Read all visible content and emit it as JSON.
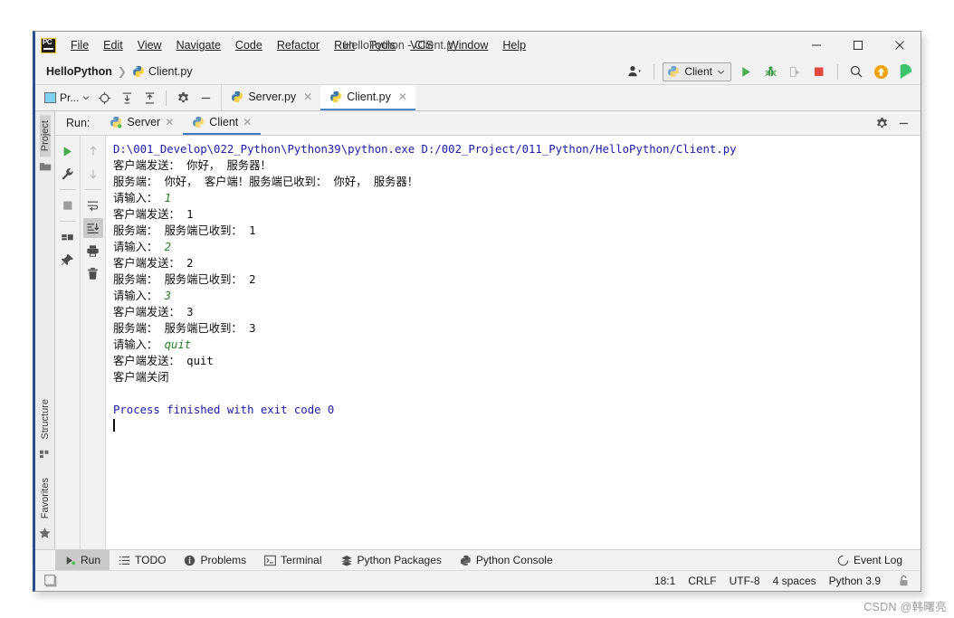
{
  "window": {
    "title": "HelloPython - Client.py",
    "app_logo": "pycharm-logo",
    "controls": {
      "minimize": "─",
      "maximize": "☐",
      "close": "✕"
    }
  },
  "menu": [
    {
      "label": "File",
      "mnemonic": "F"
    },
    {
      "label": "Edit",
      "mnemonic": "E"
    },
    {
      "label": "View",
      "mnemonic": "V"
    },
    {
      "label": "Navigate",
      "mnemonic": "N"
    },
    {
      "label": "Code",
      "mnemonic": "C"
    },
    {
      "label": "Refactor",
      "mnemonic": "R"
    },
    {
      "label": "Run",
      "mnemonic": "u"
    },
    {
      "label": "Tools",
      "mnemonic": "T"
    },
    {
      "label": "VCS",
      "mnemonic": "S"
    },
    {
      "label": "Window",
      "mnemonic": "W"
    },
    {
      "label": "Help",
      "mnemonic": "H"
    }
  ],
  "navbar": {
    "project": "HelloPython",
    "separator": "❯",
    "file": "Client.py",
    "run_config": "Client",
    "run_config_chevron": "⌄",
    "icons": [
      "user-avatar-icon",
      "run-icon",
      "debug-icon",
      "coverage-icon",
      "stop-icon",
      "search-everywhere-icon",
      "update-icon",
      "ide-features-icon"
    ]
  },
  "tabstrip": {
    "project_chip": "Pr...",
    "tool_icons": [
      "target-locate-icon",
      "expand-all-icon",
      "collapse-all-icon",
      "settings-gear-icon",
      "hide-icon"
    ],
    "editor_tabs": [
      {
        "label": "Server.py",
        "active": false,
        "close": "✕"
      },
      {
        "label": "Client.py",
        "active": true,
        "close": "✕"
      }
    ]
  },
  "leftbar": {
    "top": [
      {
        "label": "Project",
        "selected": true,
        "icon": "folder-icon"
      }
    ],
    "bottom": [
      {
        "label": "Structure",
        "selected": false,
        "icon": "structure-icon"
      },
      {
        "label": "Favorites",
        "selected": false,
        "icon": "star-icon"
      }
    ]
  },
  "run_window": {
    "label": "Run:",
    "tabs": [
      {
        "label": "Server",
        "active": false,
        "running": true,
        "close": "✕"
      },
      {
        "label": "Client",
        "active": true,
        "running": false,
        "close": "✕"
      }
    ],
    "right_icons": [
      "settings-gear-icon",
      "hide-window-icon"
    ],
    "gutter_left": [
      "rerun-icon",
      "wrench-settings-icon",
      "stop-icon",
      "layout-icon",
      "pin-icon"
    ],
    "gutter_right": [
      "scroll-up-icon",
      "scroll-down-icon",
      "soft-wrap-icon",
      "scroll-to-end-icon",
      "print-icon",
      "clear-all-icon"
    ]
  },
  "console": {
    "lines": [
      {
        "type": "cmd",
        "text": "D:\\001_Develop\\022_Python\\Python39\\python.exe D:/002_Project/011_Python/HelloPython/Client.py"
      },
      {
        "type": "out",
        "text": "客户端发送： 你好， 服务器！"
      },
      {
        "type": "out",
        "text": "服务端： 你好， 客户端！服务端已收到： 你好， 服务器！"
      },
      {
        "type": "prompt",
        "text": "请输入： ",
        "input": "1"
      },
      {
        "type": "out",
        "text": "客户端发送： 1"
      },
      {
        "type": "out",
        "text": "服务端： 服务端已收到： 1"
      },
      {
        "type": "prompt",
        "text": "请输入： ",
        "input": "2"
      },
      {
        "type": "out",
        "text": "客户端发送： 2"
      },
      {
        "type": "out",
        "text": "服务端： 服务端已收到： 2"
      },
      {
        "type": "prompt",
        "text": "请输入： ",
        "input": "3"
      },
      {
        "type": "out",
        "text": "客户端发送： 3"
      },
      {
        "type": "out",
        "text": "服务端： 服务端已收到： 3"
      },
      {
        "type": "prompt",
        "text": "请输入： ",
        "input": "quit"
      },
      {
        "type": "out",
        "text": "客户端发送： quit"
      },
      {
        "type": "out",
        "text": "客户端关闭"
      },
      {
        "type": "blank",
        "text": ""
      },
      {
        "type": "exit",
        "text": "Process finished with exit code 0"
      },
      {
        "type": "caret",
        "text": ""
      }
    ]
  },
  "bottom_bar": {
    "items": [
      {
        "label": "Run",
        "icon": "run-icon",
        "selected": true
      },
      {
        "label": "TODO",
        "icon": "todo-list-icon",
        "selected": false
      },
      {
        "label": "Problems",
        "icon": "problems-icon",
        "selected": false
      },
      {
        "label": "Terminal",
        "icon": "terminal-icon",
        "selected": false
      },
      {
        "label": "Python Packages",
        "icon": "packages-icon",
        "selected": false
      },
      {
        "label": "Python Console",
        "icon": "python-icon",
        "selected": false
      }
    ],
    "event_log": {
      "label": "Event Log",
      "icon": "event-log-icon"
    }
  },
  "status_bar": {
    "left_icon": "toggle-toolwindow-icon",
    "caret_position": "18:1",
    "line_separator": "CRLF",
    "encoding": "UTF-8",
    "indent": "4 spaces",
    "interpreter": "Python 3.9",
    "lock_icon": "write-lock-icon"
  },
  "watermark": "CSDN @韩曙亮",
  "colors": {
    "accent_blue": "#3d79c4",
    "console_cmd": "#1a1aa8",
    "console_input": "#267f26",
    "window_border": "#2a4f8f",
    "chrome_bg": "#f2f2f2"
  }
}
